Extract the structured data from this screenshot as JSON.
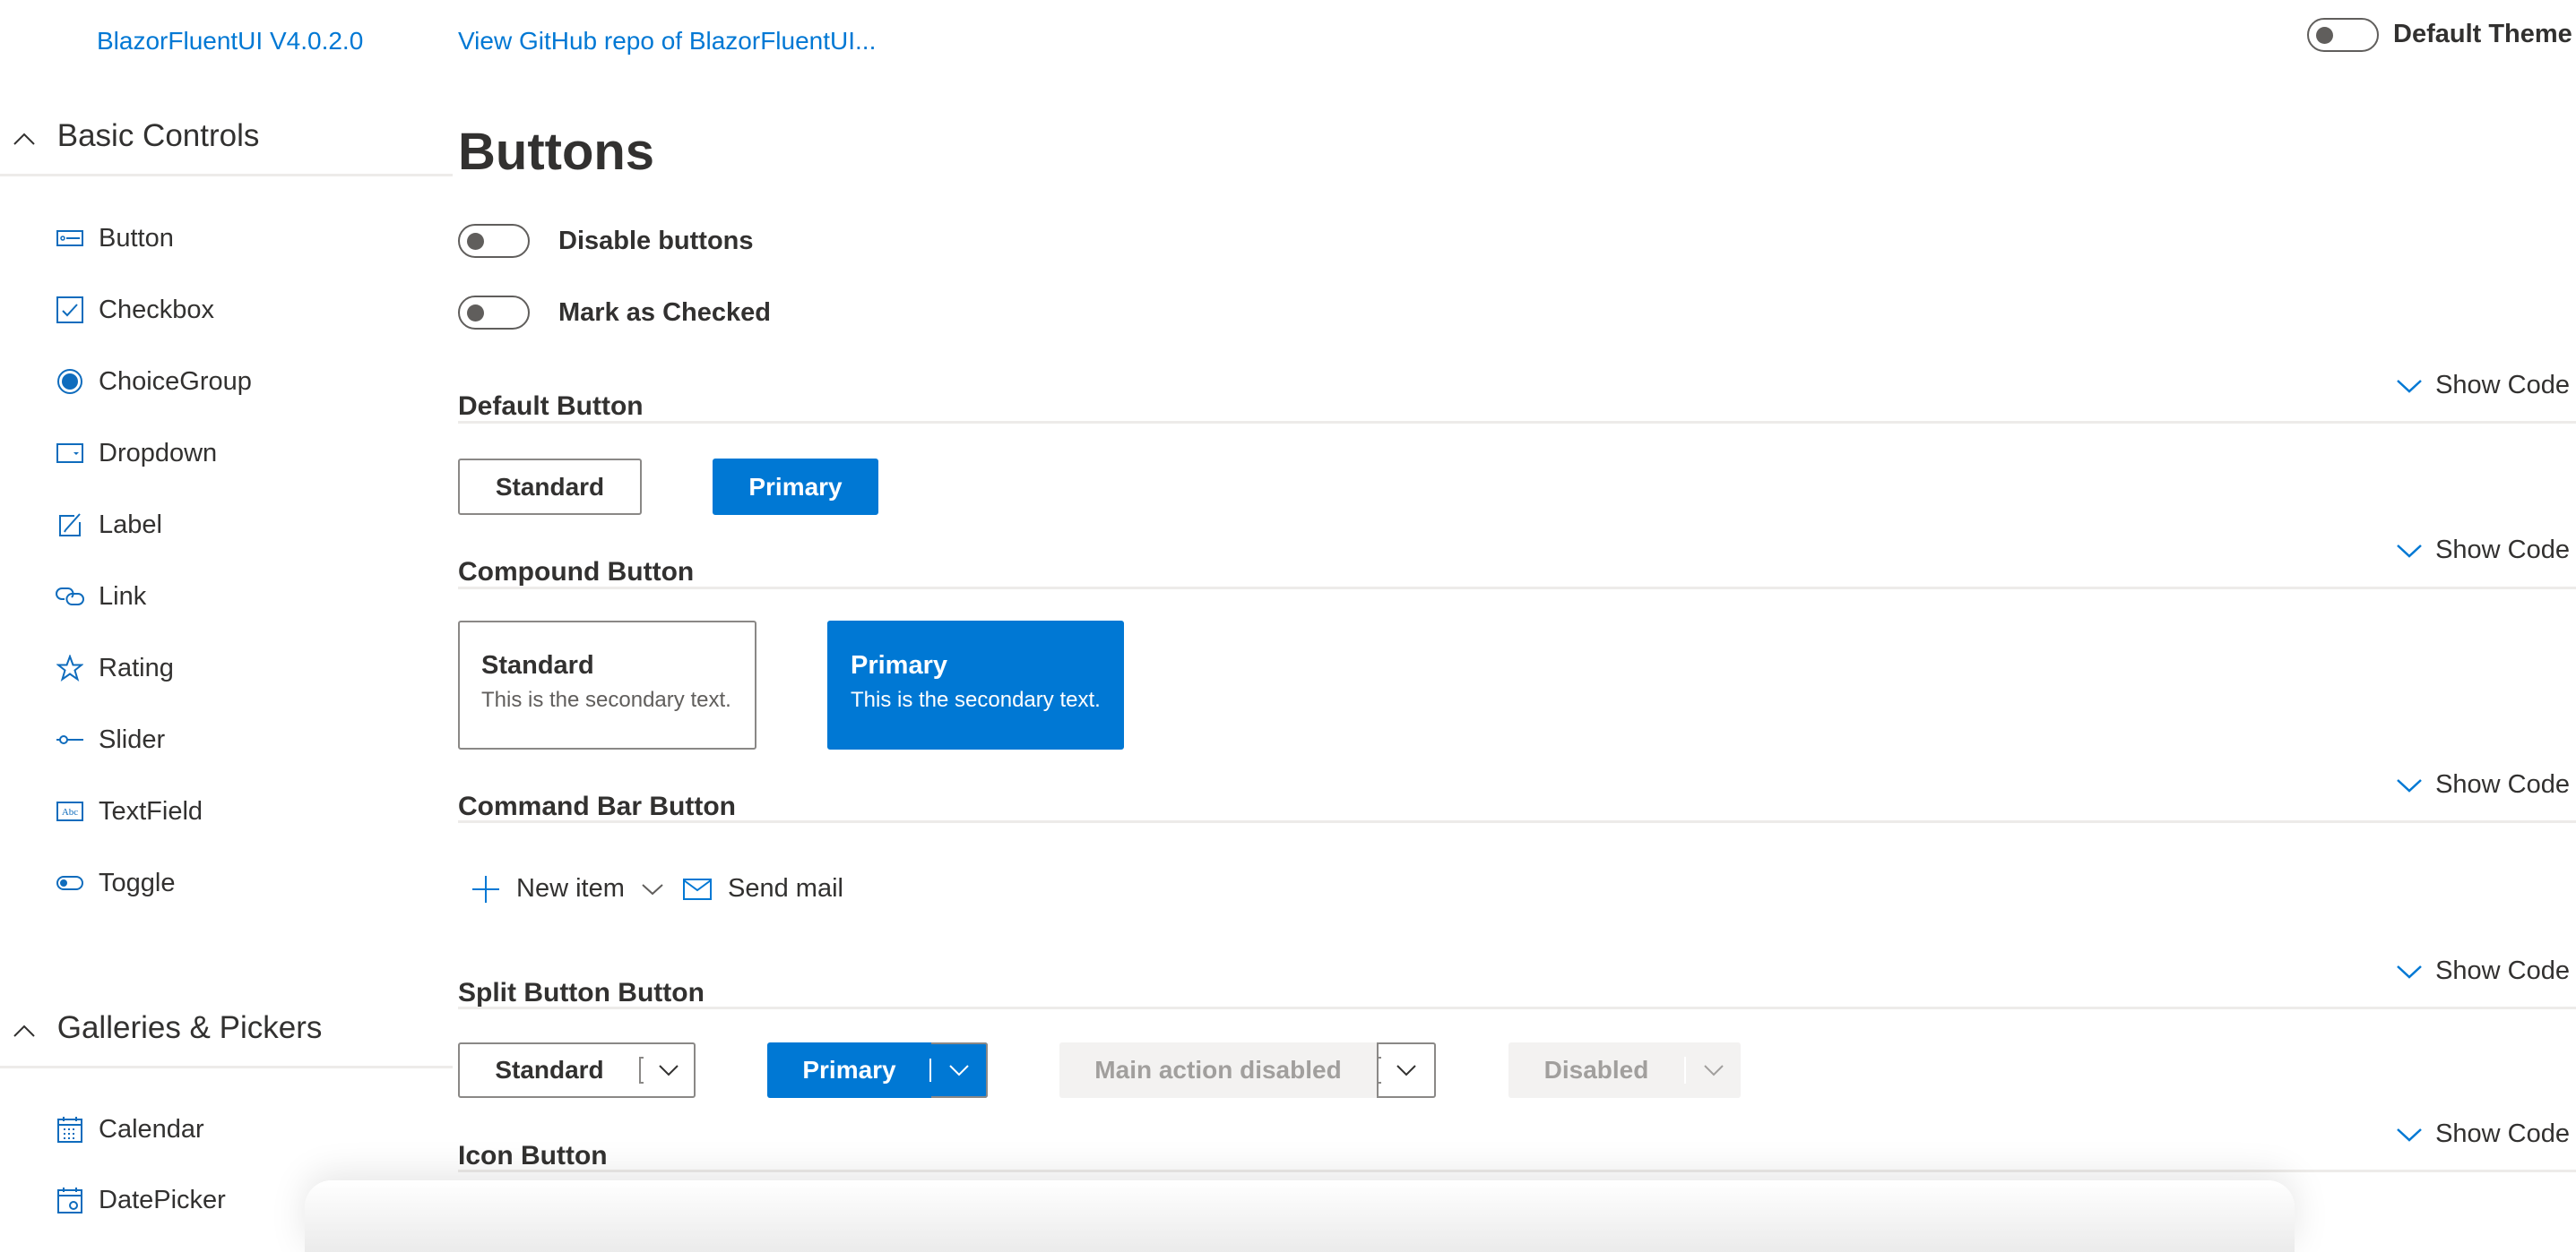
{
  "header": {
    "version_link": "BlazorFluentUI V4.0.2.0",
    "github_link": "View GitHub repo of BlazorFluentUI...",
    "theme_toggle_label": "Default Theme",
    "theme_toggle_on": false
  },
  "sidebar": {
    "groups": [
      {
        "title": "Basic Controls",
        "expanded": true,
        "items": [
          {
            "label": "Button",
            "icon": "button-icon"
          },
          {
            "label": "Checkbox",
            "icon": "checkbox-icon"
          },
          {
            "label": "ChoiceGroup",
            "icon": "radio-button-icon"
          },
          {
            "label": "Dropdown",
            "icon": "dropdown-icon"
          },
          {
            "label": "Label",
            "icon": "edit-icon"
          },
          {
            "label": "Link",
            "icon": "link-icon"
          },
          {
            "label": "Rating",
            "icon": "star-icon"
          },
          {
            "label": "Slider",
            "icon": "slider-icon"
          },
          {
            "label": "TextField",
            "icon": "textfield-icon"
          },
          {
            "label": "Toggle",
            "icon": "toggle-icon"
          }
        ]
      },
      {
        "title": "Galleries & Pickers",
        "expanded": true,
        "items": [
          {
            "label": "Calendar",
            "icon": "calendar-icon"
          },
          {
            "label": "DatePicker",
            "icon": "date-picker-icon"
          }
        ]
      }
    ]
  },
  "main": {
    "title": "Buttons",
    "toggles": [
      {
        "label": "Disable buttons",
        "on": false
      },
      {
        "label": "Mark as Checked",
        "on": false
      }
    ],
    "show_code_label": "Show Code",
    "sections": {
      "default": {
        "title": "Default Button",
        "standard": "Standard",
        "primary": "Primary"
      },
      "compound": {
        "title": "Compound Button",
        "standard": {
          "label": "Standard",
          "secondary": "This is the secondary text."
        },
        "primary": {
          "label": "Primary",
          "secondary": "This is the secondary text."
        }
      },
      "command_bar": {
        "title": "Command Bar Button",
        "items": [
          {
            "label": "New item",
            "icon": "add-icon",
            "has_menu": true
          },
          {
            "label": "Send mail",
            "icon": "mail-icon",
            "has_menu": false
          }
        ]
      },
      "split": {
        "title": "Split Button Button",
        "buttons": [
          {
            "label": "Standard",
            "variant": "standard"
          },
          {
            "label": "Primary",
            "variant": "primary"
          },
          {
            "label": "Main action disabled",
            "variant": "main-disabled"
          },
          {
            "label": "Disabled",
            "variant": "disabled"
          }
        ]
      },
      "icon": {
        "title": "Icon Button"
      }
    }
  },
  "colors": {
    "accent": "#0078d4",
    "text": "#323130",
    "disabled_bg": "#f3f2f1",
    "disabled_text": "#a19f9d",
    "divider": "#edebe9"
  }
}
